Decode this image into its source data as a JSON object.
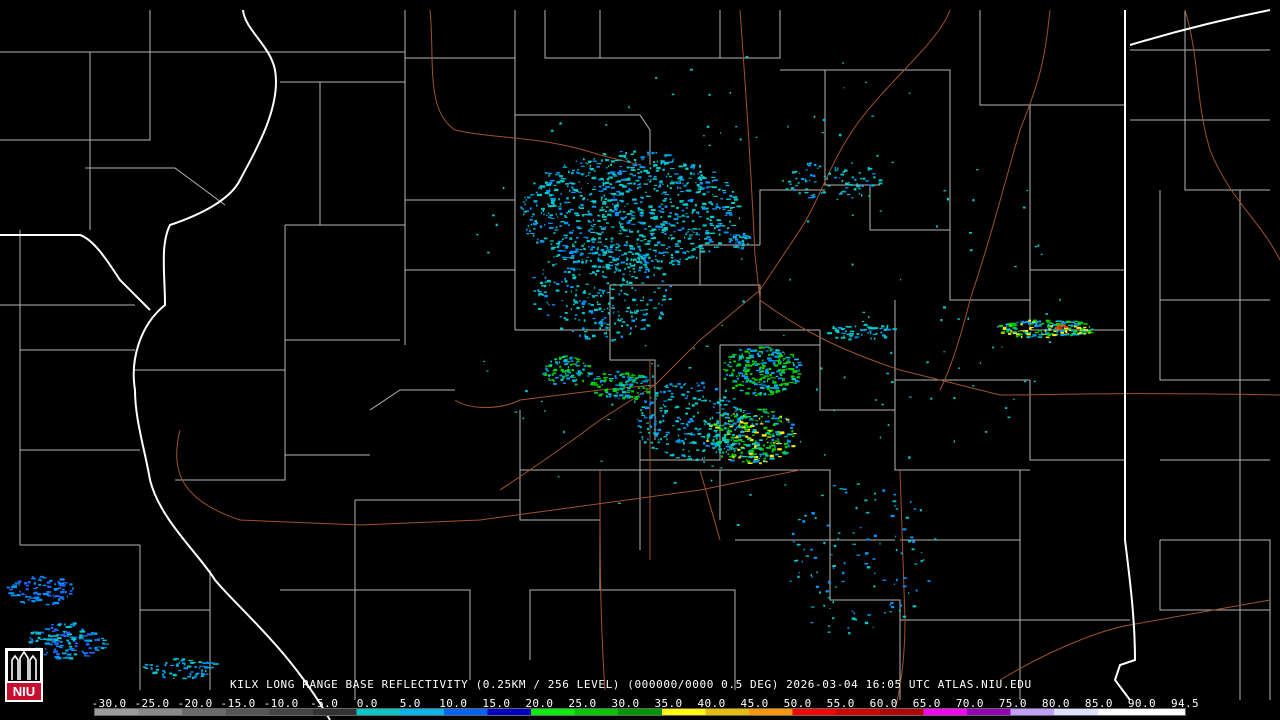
{
  "caption": "KILX LONG RANGE BASE REFLECTIVITY (0.25KM / 256 LEVEL) (000000/0000 0.5 DEG) 2026-03-04 16:05 UTC  ATLAS.NIU.EDU",
  "logo": {
    "text": "NIU",
    "icon": "niu-logo-icon",
    "color": "#c8102e"
  },
  "colorbar": {
    "labels": [
      "-30.0",
      "-25.0",
      "-20.0",
      "-15.0",
      "-10.0",
      "-5.0",
      "0.0",
      "5.0",
      "10.0",
      "15.0",
      "20.0",
      "25.0",
      "30.0",
      "35.0",
      "40.0",
      "45.0",
      "50.0",
      "55.0",
      "60.0",
      "65.0",
      "70.0",
      "75.0",
      "80.0",
      "85.0",
      "90.0",
      "94.5"
    ],
    "colors": [
      "#9c9c9c",
      "#8a8a8a",
      "#6a6a6a",
      "#555555",
      "#444444",
      "#333333",
      "#00c8c8",
      "#00b4f0",
      "#0064ff",
      "#0000c8",
      "#00f000",
      "#00c800",
      "#009600",
      "#ffff00",
      "#e6be00",
      "#ff9600",
      "#ff0000",
      "#d20000",
      "#b40000",
      "#ff00ff",
      "#9600b4",
      "#c0a0ff",
      "#e0e0ff",
      "#ffffff",
      "#ffffff"
    ]
  },
  "map_colors": {
    "county_lines": "#b4b4b4",
    "state_lines": "#ffffff",
    "highways": "#a0522d",
    "echo_light": "#00c8c8",
    "echo_mid": "#0096ff",
    "echo_green": "#00d200",
    "echo_yellow": "#f0f000",
    "echo_red": "#ff3c00"
  }
}
